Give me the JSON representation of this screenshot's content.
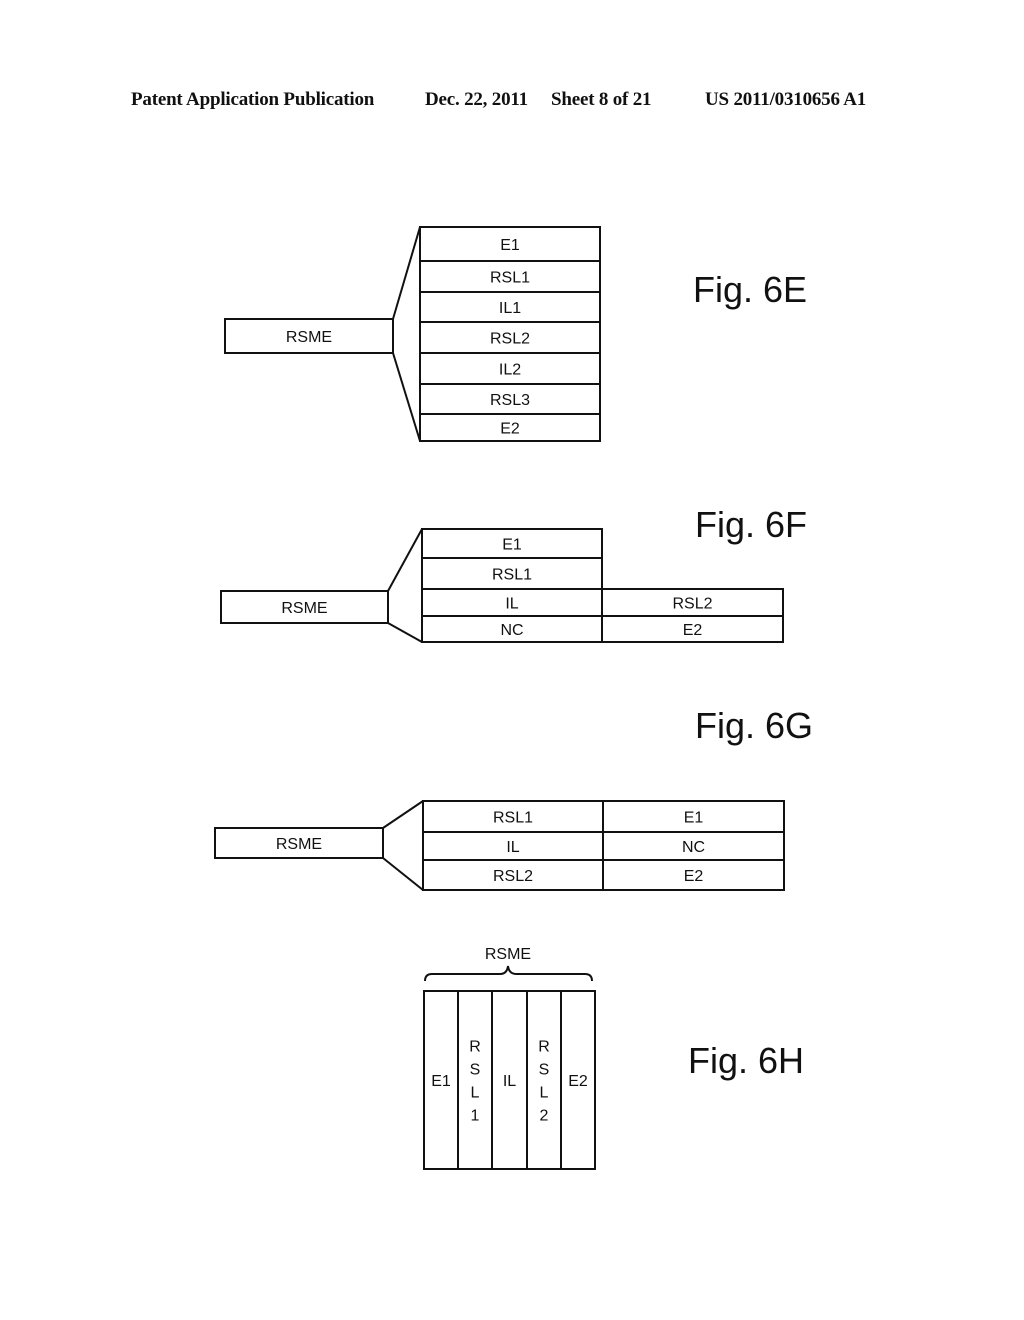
{
  "header": {
    "publication": "Patent Application Publication",
    "date": "Dec. 22, 2011",
    "sheet": "Sheet 8 of 21",
    "number": "US 2011/0310656 A1"
  },
  "figures": {
    "fig6e": {
      "caption": "Fig. 6E",
      "source": "RSME",
      "layers": [
        "E1",
        "RSL1",
        "IL1",
        "RSL2",
        "IL2",
        "RSL3",
        "E2"
      ]
    },
    "fig6f": {
      "caption": "Fig. 6F",
      "source": "RSME",
      "left_column": [
        "E1",
        "RSL1",
        "IL",
        "NC"
      ],
      "right_column": [
        "RSL2",
        "E2"
      ]
    },
    "fig6g": {
      "caption": "Fig. 6G",
      "source": "RSME",
      "left_column": [
        "RSL1",
        "IL",
        "RSL2"
      ],
      "right_column": [
        "E1",
        "NC",
        "E2"
      ]
    },
    "fig6h": {
      "caption": "Fig. 6H",
      "brace_label": "RSME",
      "columns": [
        "E1",
        "RSL1",
        "IL",
        "RSL2",
        "E2"
      ]
    }
  }
}
